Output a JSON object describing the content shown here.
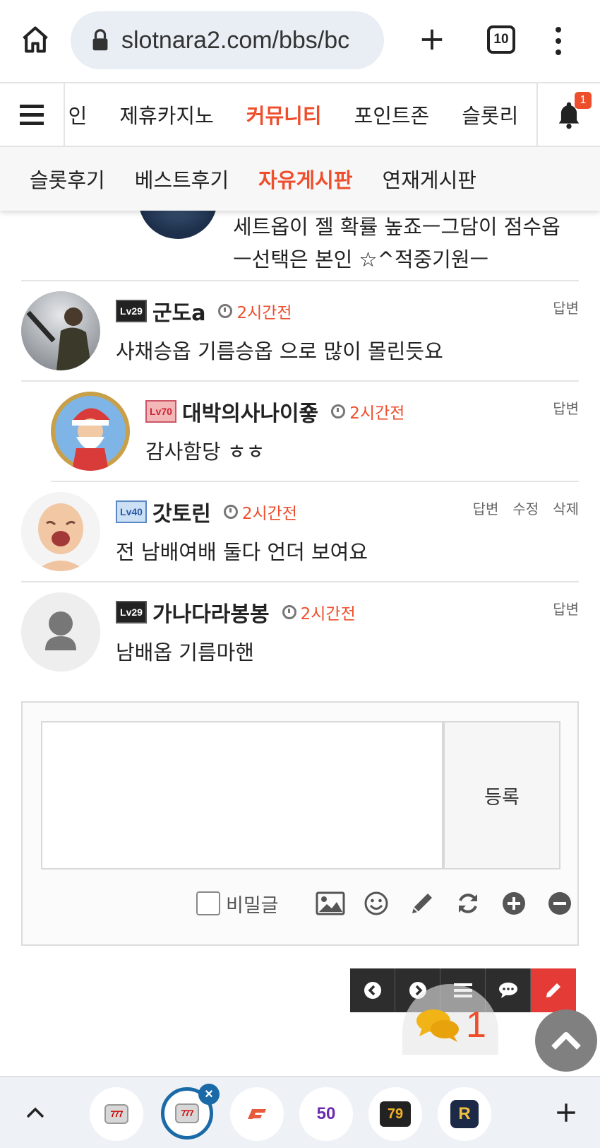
{
  "browser": {
    "url": "slotnara2.com/bbs/bc",
    "tab_count": "10"
  },
  "site_nav": {
    "items": [
      "메인",
      "제휴카지노",
      "커뮤니티",
      "포인트존",
      "슬롯리"
    ],
    "active_index": 2,
    "notification_count": "1"
  },
  "sub_nav": {
    "items": [
      "슬롯후기",
      "베스트후기",
      "자유게시판",
      "연재게시판"
    ],
    "active_index": 2
  },
  "partial_comment": {
    "text": "세트옵이 젤 확률 높죠ㅡ그담이 점수옵 ㅡ선택은 본인 ☆^적중기원ㅡ"
  },
  "comments": [
    {
      "level": "Lv29",
      "nickname": "군도a",
      "time": "2시간전",
      "text": "사채승옵 기름승옵 으로 많이 몰린듯요",
      "actions": [
        "답변"
      ],
      "reply": false
    },
    {
      "level": "Lv70",
      "nickname": "대박의사나이죻",
      "time": "2시간전",
      "text": "감사함당 ㅎㅎ",
      "actions": [
        "답변"
      ],
      "reply": true
    },
    {
      "level": "Lv40",
      "nickname": "갓토린",
      "time": "2시간전",
      "text": "전 남배여배 둘다 언더 보여요",
      "actions": [
        "답변",
        "수정",
        "삭제"
      ],
      "reply": false
    },
    {
      "level": "Lv29",
      "nickname": "가나다라봉봉",
      "time": "2시간전",
      "text": "남배옵 기름마핸",
      "actions": [
        "답변"
      ],
      "reply": false
    }
  ],
  "comment_form": {
    "submit_label": "등록",
    "secret_label": "비밀글",
    "tools": [
      "image-icon",
      "smile-icon",
      "pencil-icon",
      "refresh-icon",
      "plus-circle-icon",
      "minus-circle-icon"
    ]
  },
  "floating": {
    "chat_count": "1"
  },
  "tab_strip": {
    "tabs": [
      "777",
      "777",
      "",
      "50",
      "79",
      "R"
    ]
  },
  "colors": {
    "accent": "#ee4e2c",
    "write_button": "#e43b37",
    "dark_button": "#2d2d2d"
  }
}
